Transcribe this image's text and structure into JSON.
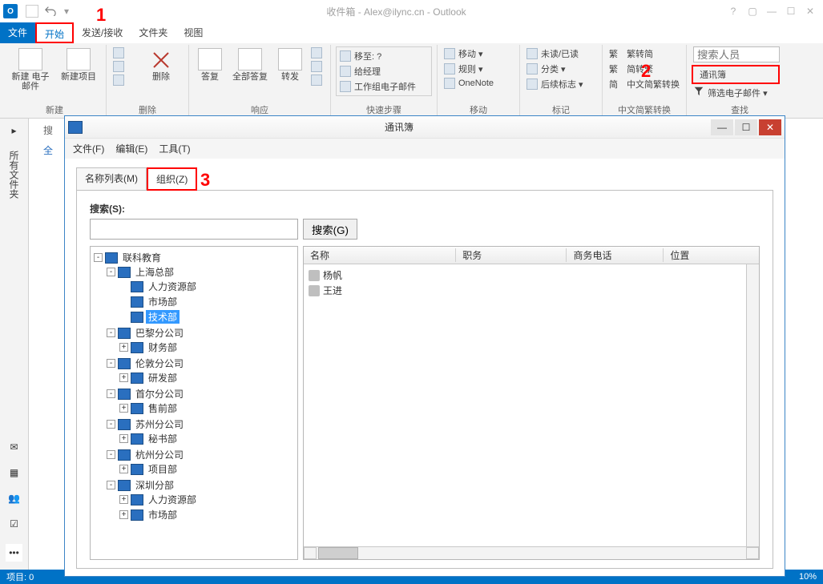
{
  "window": {
    "title": "收件箱 - Alex@ilync.cn - Outlook",
    "app_letter": "O"
  },
  "tabs": {
    "file": "文件",
    "home": "开始",
    "sendreceive": "发送/接收",
    "folder": "文件夹",
    "view": "视图"
  },
  "ribbon": {
    "new": {
      "label": "新建",
      "mail": "新建\n电子邮件",
      "item": "新建项目"
    },
    "delete": {
      "label": "删除",
      "btn": "删除"
    },
    "respond": {
      "label": "响应",
      "reply": "答复",
      "replyall": "全部答复",
      "forward": "转发"
    },
    "quick": {
      "label": "快速步骤",
      "move": "移至: ?",
      "mgr": "给经理",
      "team": "工作组电子邮件"
    },
    "move": {
      "label": "移动",
      "mv": "移动 ▾",
      "rules": "规则 ▾",
      "onenote": "OneNote"
    },
    "tags": {
      "label": "标记",
      "unread": "未读/已读",
      "cat": "分类 ▾",
      "follow": "后续标志 ▾"
    },
    "conv": {
      "label": "中文简繁转换",
      "a": "繁转简",
      "b": "简转繁",
      "c": "中文简繁转换"
    },
    "find": {
      "label": "查找",
      "placeholder": "搜索人员",
      "addressbook": "通讯簿",
      "filter": "筛选电子邮件 ▾"
    }
  },
  "annot": {
    "one": "1",
    "two": "2",
    "three": "3"
  },
  "sidebar": {
    "all": "所有文件夹",
    "new_text": "搜",
    "start": "全"
  },
  "status": {
    "left": "项目: 0",
    "right": "10%"
  },
  "dialog": {
    "title": "通讯簿",
    "menu": {
      "file": "文件(F)",
      "edit": "编辑(E)",
      "tools": "工具(T)"
    },
    "tabs": {
      "namelist": "名称列表(M)",
      "org": "组织(Z)"
    },
    "search": {
      "label": "搜索(S):",
      "button": "搜索(G)"
    },
    "cols": {
      "name": "名称",
      "title": "职务",
      "phone": "商务电话",
      "loc": "位置"
    },
    "tree": {
      "root": "联科教育",
      "b1": "上海总部",
      "b1_1": "人力资源部",
      "b1_2": "市场部",
      "b1_3": "技术部",
      "b2": "巴黎分公司",
      "b2_1": "财务部",
      "b3": "伦敦分公司",
      "b3_1": "研发部",
      "b4": "首尔分公司",
      "b4_1": "售前部",
      "b5": "苏州分公司",
      "b5_1": "秘书部",
      "b6": "杭州分公司",
      "b6_1": "项目部",
      "b7": "深圳分部",
      "b7_1": "人力资源部",
      "b7_2": "市场部"
    },
    "people": {
      "p1": "杨帆",
      "p2": "王进"
    }
  }
}
